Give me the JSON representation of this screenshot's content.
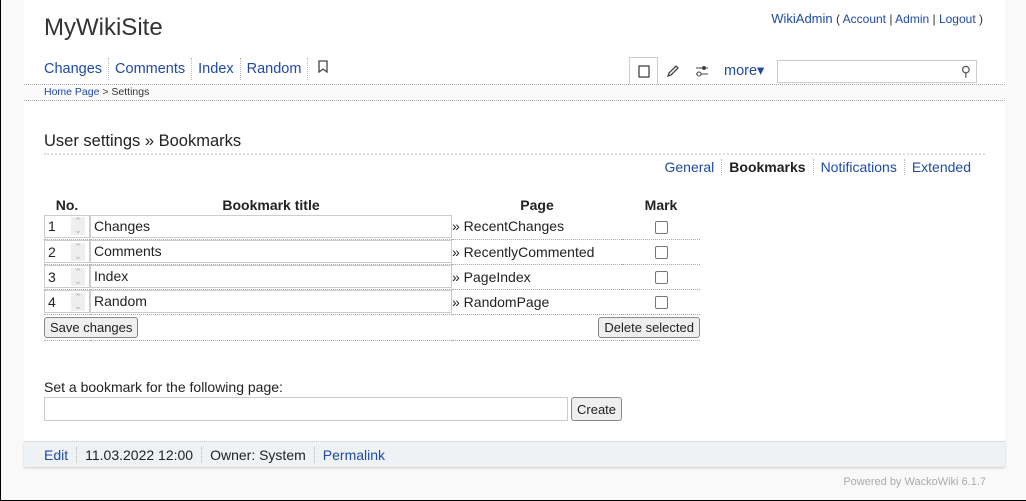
{
  "site_title": "MyWikiSite",
  "user": {
    "name": "WikiAdmin",
    "links": [
      "Account",
      "Admin",
      "Logout"
    ]
  },
  "nav": [
    "Changes",
    "Comments",
    "Index",
    "Random"
  ],
  "icons": {
    "bookmark": "bookmark-icon",
    "show": "square-icon",
    "edit": "pencil-icon",
    "properties": "sliders-icon",
    "search": "search-icon"
  },
  "more_label": "more▾",
  "search": {
    "value": ""
  },
  "breadcrumb": {
    "home": "Home Page",
    "sep": " > ",
    "current": "Settings"
  },
  "heading": "User settings » Bookmarks",
  "tabs": [
    "General",
    "Bookmarks",
    "Notifications",
    "Extended"
  ],
  "table": {
    "headers": [
      "No.",
      "Bookmark title",
      "Page",
      "Mark"
    ],
    "rows": [
      {
        "no": "1",
        "title": "Changes",
        "page": "» RecentChanges",
        "checked": false
      },
      {
        "no": "2",
        "title": "Comments",
        "page": "» RecentlyCommented",
        "checked": false
      },
      {
        "no": "3",
        "title": "Index",
        "page": "» PageIndex",
        "checked": false
      },
      {
        "no": "4",
        "title": "Random",
        "page": "» RandomPage",
        "checked": false
      }
    ],
    "save_label": "Save changes",
    "delete_label": "Delete selected"
  },
  "new_bookmark": {
    "label": "Set a bookmark for the following page:",
    "value": "",
    "create_label": "Create"
  },
  "footer": {
    "edit": "Edit",
    "date": "11.03.2022 12:00",
    "owner": "Owner: System",
    "permalink": "Permalink"
  },
  "powered": "Powered by WackoWiki 6.1.7"
}
